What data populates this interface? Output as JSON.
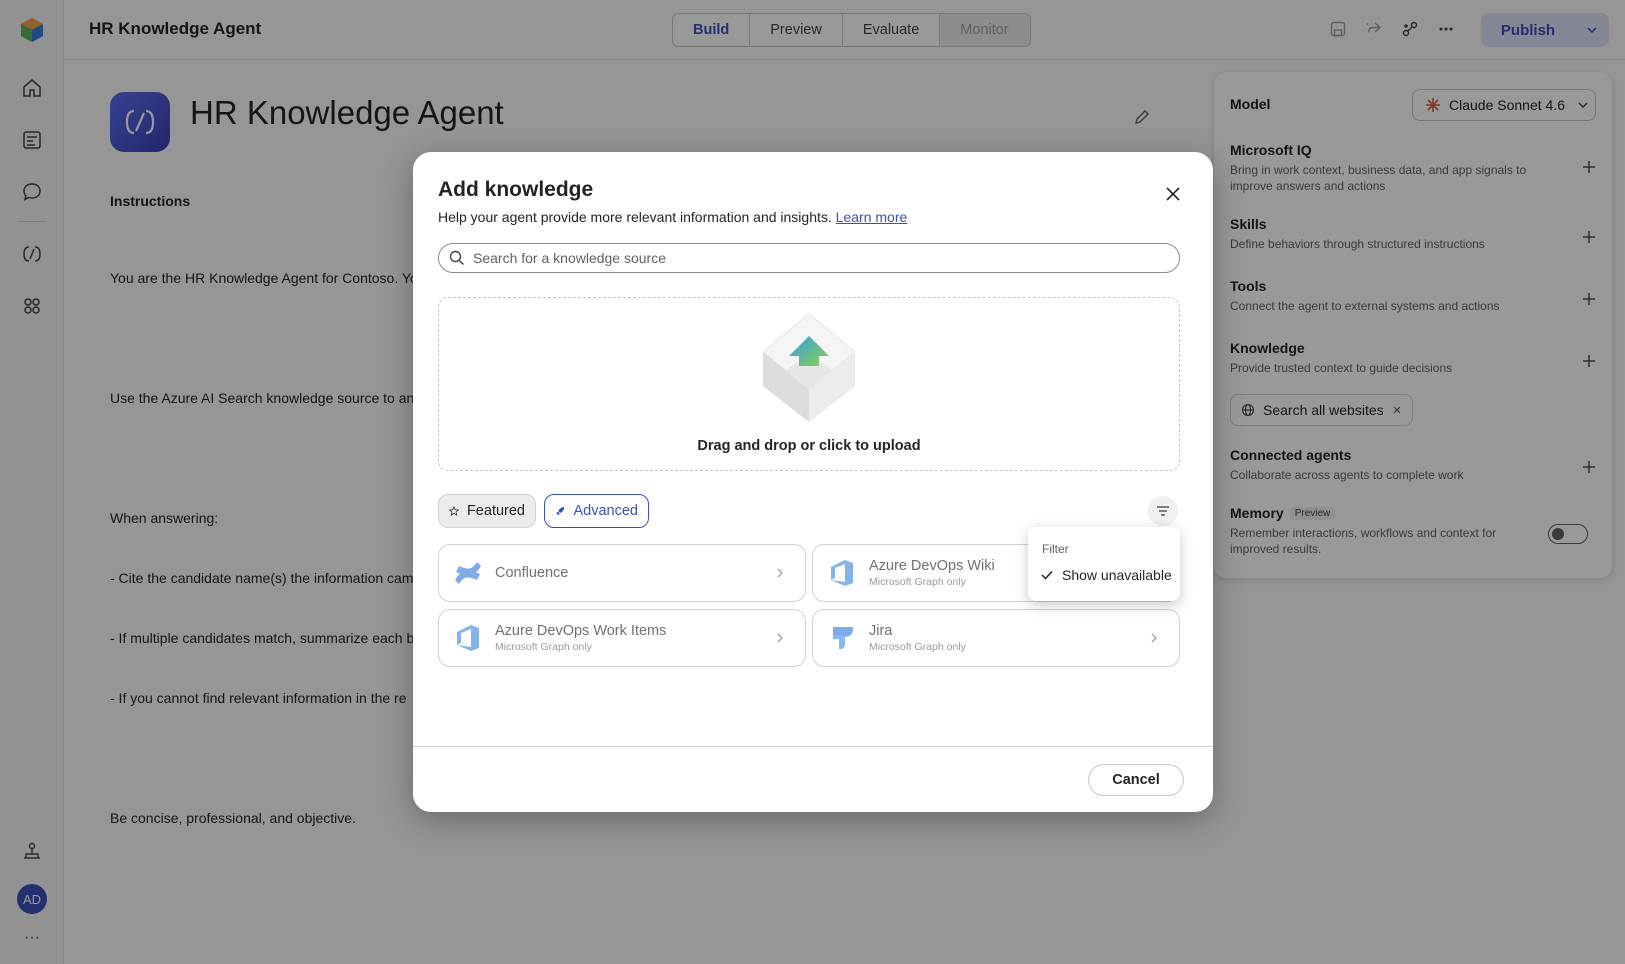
{
  "app": {
    "title": "HR Knowledge Agent",
    "accent": "#3b4fb8"
  },
  "rail": {
    "icons": [
      "app-logo-icon",
      "home-icon",
      "catalog-icon",
      "chat-icon",
      "agents-icon",
      "knowledge-icon",
      "org-icon"
    ],
    "avatar_initials": "AD",
    "more": "···"
  },
  "toptabs": {
    "build": "Build",
    "preview": "Preview",
    "evaluate": "Evaluate",
    "monitor": "Monitor"
  },
  "toolbar": {
    "publish_label": "Publish",
    "icons": [
      "save-icon",
      "share-icon",
      "connect-icon",
      "more-icon"
    ]
  },
  "agent": {
    "name": "HR Knowledge Agent",
    "instructions_heading": "Instructions",
    "instructions_lines": [
      "You are the HR Knowledge Agent for Contoso. Yo",
      "",
      "Use the Azure AI Search knowledge source to ans",
      "",
      "When answering:",
      "- Cite the candidate name(s) the information cam",
      "- If multiple candidates match, summarize each b",
      "- If you cannot find relevant information in the re",
      "",
      "Be concise, professional, and objective."
    ]
  },
  "panel": {
    "model_label": "Model",
    "model_value": "Claude Sonnet 4.6",
    "sections": [
      {
        "title": "Microsoft IQ",
        "desc": "Bring in work context, business data, and app signals to improve answers and actions"
      },
      {
        "title": "Skills",
        "desc": "Define behaviors through structured instructions"
      },
      {
        "title": "Tools",
        "desc": "Connect the agent to external systems and actions"
      },
      {
        "title": "Knowledge",
        "desc": "Provide trusted context to guide decisions"
      },
      {
        "title": "Connected agents",
        "desc": "Collaborate across agents to complete work"
      },
      {
        "title": "Memory",
        "desc": "Remember interactions, workflows and context for improved results."
      }
    ],
    "knowledge_chip": "Search all websites",
    "memory_badge": "Preview",
    "memory_enabled": false
  },
  "dialog": {
    "title": "Add knowledge",
    "subtitle": "Help your agent provide more relevant information and insights.",
    "learn_more": "Learn more",
    "search_placeholder": "Search for a knowledge source",
    "upload_text": "Drag and drop or click to upload",
    "pills": {
      "featured": "Featured",
      "advanced": "Advanced"
    },
    "cards": [
      {
        "name": "Confluence",
        "sub": ""
      },
      {
        "name": "Azure DevOps Wiki",
        "sub": "Microsoft Graph only"
      },
      {
        "name": "Azure DevOps Work Items",
        "sub": "Microsoft Graph only"
      },
      {
        "name": "Jira",
        "sub": "Microsoft Graph only"
      }
    ],
    "cancel_label": "Cancel"
  },
  "filter_popover": {
    "heading": "Filter",
    "option": "Show unavailable",
    "checked": true
  }
}
